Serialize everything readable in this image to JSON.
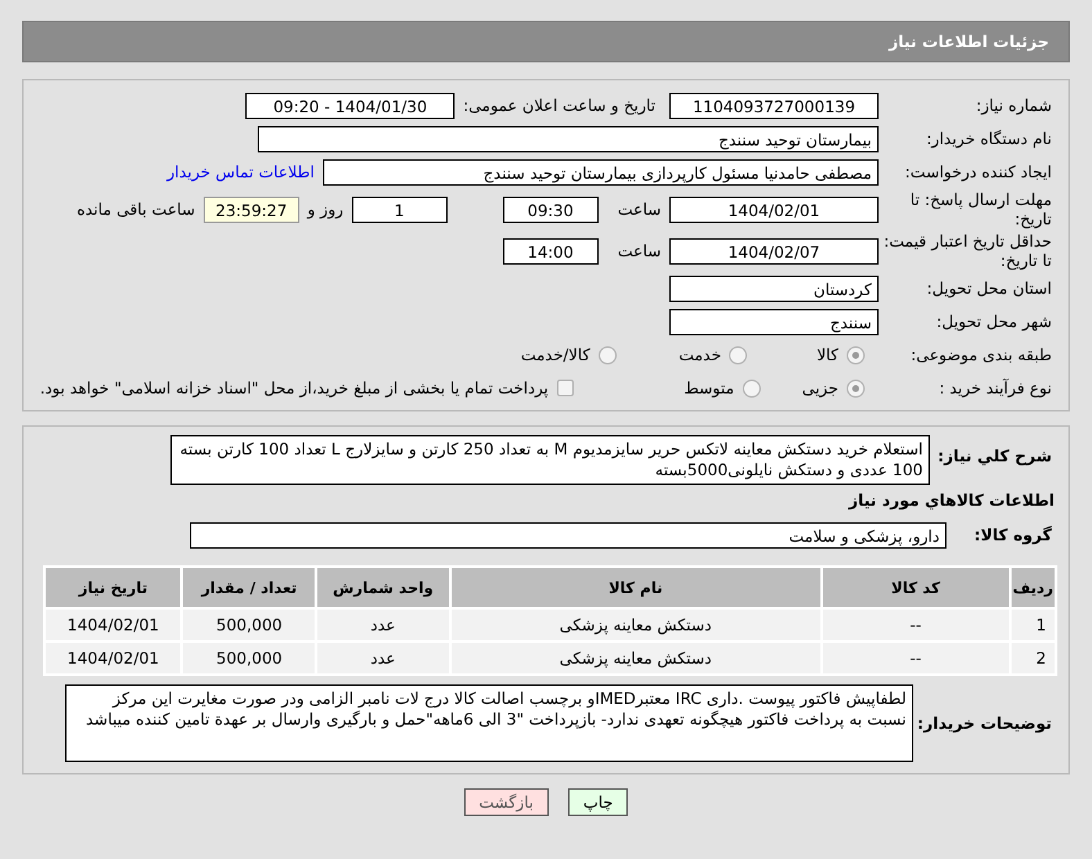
{
  "header": {
    "title": "جزئیات اطلاعات نیاز"
  },
  "need_number": {
    "label": "شماره نیاز:",
    "value": "1104093727000139"
  },
  "announce": {
    "label": "تاریخ و ساعت اعلان عمومی:",
    "value": "1404/01/30 - 09:20"
  },
  "buyer_org": {
    "label": "نام دستگاه خریدار:",
    "value": "بیمارستان توحید سنندج"
  },
  "requester": {
    "label": "ایجاد کننده درخواست:",
    "value": "مصطفی حامدنیا مسئول کارپردازی بیمارستان توحید سنندج",
    "link": "اطلاعات تماس خریدار"
  },
  "deadline": {
    "label": "مهلت ارسال پاسخ: تا تاریخ:",
    "date": "1404/02/01",
    "time_label": "ساعت",
    "time": "09:30",
    "days": "1",
    "days_label": "روز و",
    "remaining": "23:59:27",
    "remaining_label": "ساعت باقی مانده"
  },
  "validity": {
    "label": "حداقل تاریخ اعتبار قیمت: تا تاریخ:",
    "date": "1404/02/07",
    "time_label": "ساعت",
    "time": "14:00"
  },
  "province": {
    "label": "استان محل تحویل:",
    "value": "کردستان"
  },
  "city": {
    "label": "شهر محل تحویل:",
    "value": "سنندج"
  },
  "category": {
    "label": "طبقه بندی موضوعی:",
    "options": [
      {
        "label": "کالا",
        "selected": true
      },
      {
        "label": "خدمت",
        "selected": false
      },
      {
        "label": "کالا/خدمت",
        "selected": false
      }
    ]
  },
  "process": {
    "label": "نوع فرآیند خرید :",
    "options": [
      {
        "label": "جزیی",
        "selected": true
      },
      {
        "label": "متوسط",
        "selected": false
      }
    ],
    "checkbox": {
      "checked": false,
      "label": "پرداخت تمام یا بخشی از مبلغ خرید،از محل \"اسناد خزانه اسلامی\" خواهد بود."
    }
  },
  "description": {
    "label": "شرح کلي نياز:",
    "value": "استعلام خرید دستکش معاینه لاتکس حریر سایزمدیوم  M به تعداد 250 کارتن  و سایزلارج  L  تعداد 100 کارتن بسته 100 عددی و دستکش نایلونی5000بسته"
  },
  "goods_heading": "اطلاعات کالاهاي مورد نياز",
  "goods_group": {
    "label": "گروه کالا:",
    "value": "دارو، پزشکی و سلامت"
  },
  "table": {
    "columns": [
      "ردیف",
      "کد کالا",
      "نام کالا",
      "واحد شمارش",
      "تعداد / مقدار",
      "تاریخ نیاز"
    ],
    "rows": [
      [
        "1",
        "--",
        "دستکش معاینه پزشکی",
        "عدد",
        "500,000",
        "1404/02/01"
      ],
      [
        "2",
        "--",
        "دستکش معاینه پزشکی",
        "عدد",
        "500,000",
        "1404/02/01"
      ]
    ]
  },
  "buyer_notes": {
    "label": "توضیحات خریدار:",
    "value": "لطفاپیش فاکتور پیوست .داری IRC معتبرIMEDو برچسب اصالت کالا درج لات نامبر الزامی ودر صورت مغایرت این مرکز نسبت به پرداخت فاکتور هیچگونه تعهدی ندارد- بازپرداخت \"3 الی 6ماهه\"حمل و بارگیری وارسال بر عهدة تامین کننده میباشد"
  },
  "buttons": [
    {
      "label": "چاپ",
      "kind": "print"
    },
    {
      "label": "بازگشت",
      "kind": "back"
    }
  ]
}
